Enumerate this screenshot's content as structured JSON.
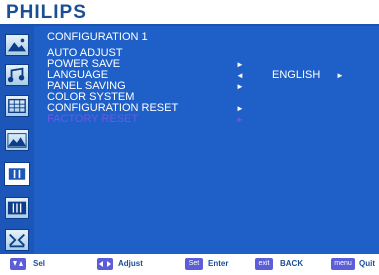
{
  "header": {
    "brand": "PHILIPS"
  },
  "menu": {
    "title": "CONFIGURATION 1",
    "items": [
      {
        "label": "AUTO ADJUST",
        "arrow": "",
        "value": ""
      },
      {
        "label": "POWER SAVE",
        "arrow": "►",
        "value": ""
      },
      {
        "label": "LANGUAGE",
        "arrow": "◄",
        "value": "ENGLISH",
        "value_arrow": "►"
      },
      {
        "label": "PANEL SAVING",
        "arrow": "►",
        "value": ""
      },
      {
        "label": "COLOR SYSTEM",
        "arrow": "",
        "value": ""
      },
      {
        "label": "CONFIGURATION RESET",
        "arrow": "►",
        "value": ""
      },
      {
        "label": "FACTORY RESET",
        "arrow": "►",
        "value": "",
        "disabled": true
      }
    ]
  },
  "sidebar": {
    "items": [
      {
        "name": "picture-icon",
        "active": false
      },
      {
        "name": "audio-icon",
        "active": false
      },
      {
        "name": "grid-icon",
        "active": false
      },
      {
        "name": "screen-icon",
        "active": false
      },
      {
        "name": "configuration-1-icon",
        "active": true
      },
      {
        "name": "configuration-2-icon",
        "active": false
      },
      {
        "name": "advanced-icon",
        "active": false
      }
    ]
  },
  "footer": {
    "sel": "Sel",
    "adjust": "Adjust",
    "set_key": "Set",
    "enter": "Enter",
    "exit_key": "exit",
    "back": "BACK",
    "menu_key": "menu",
    "quit": "Quit"
  },
  "colors": {
    "brand": "#1a4f95",
    "panel": "#1f60c8",
    "sidebar": "#1b56b8",
    "disabled": "#6b57e6",
    "key": "#5b5ed6"
  }
}
